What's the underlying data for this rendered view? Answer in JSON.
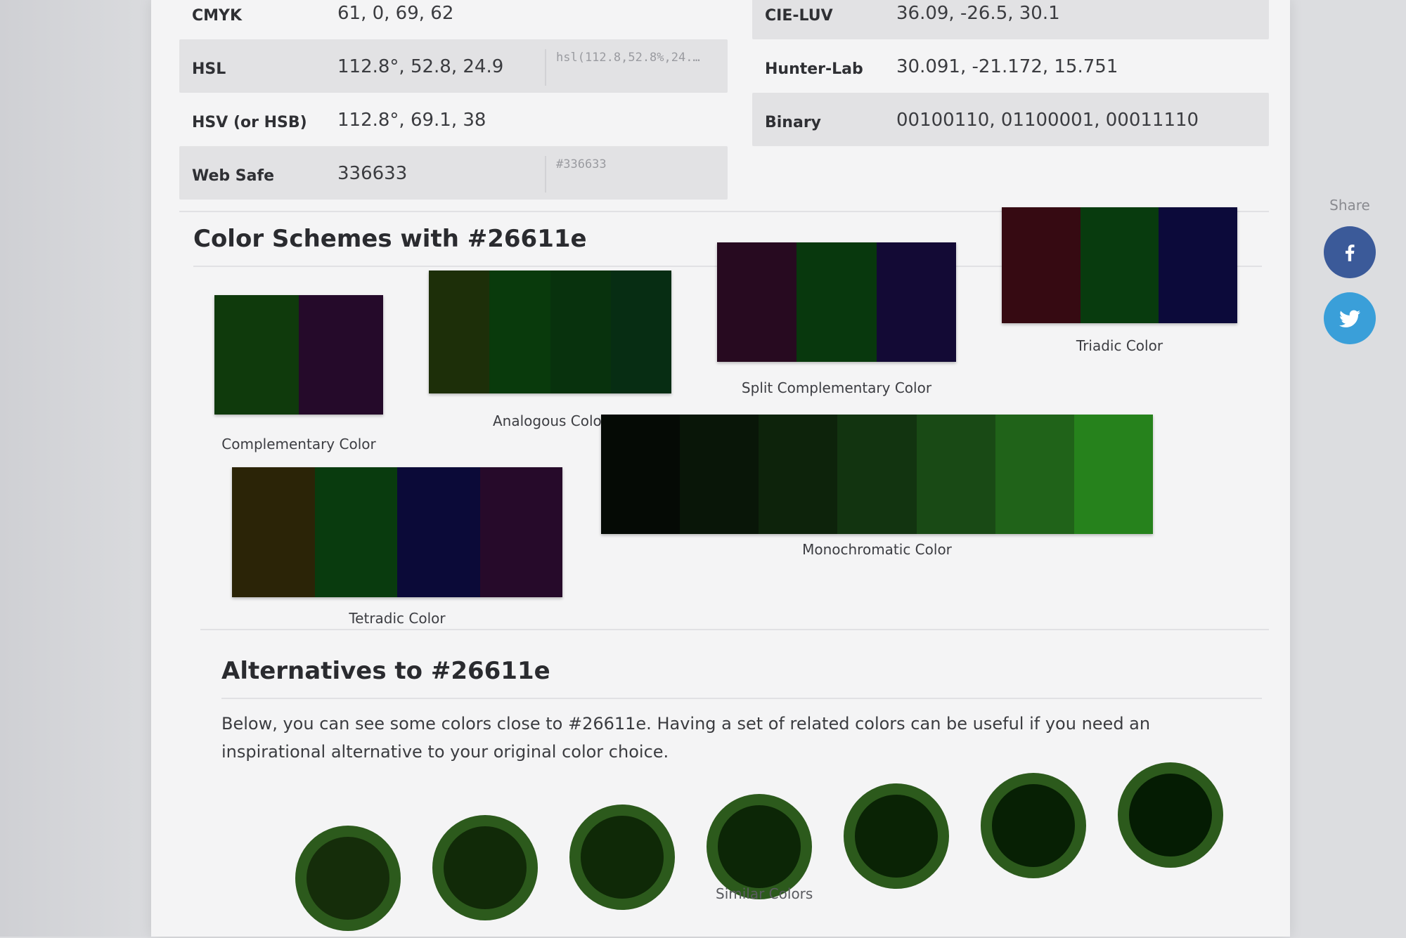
{
  "color": {
    "hex": "#26611e"
  },
  "conversions": {
    "left": [
      {
        "label": "CMYK",
        "value": "61, 0, 69, 62",
        "css": ""
      },
      {
        "label": "HSL",
        "value": "112.8°, 52.8, 24.9",
        "css": "hsl(112.8,52.8%,24.…"
      },
      {
        "label": "HSV (or HSB)",
        "value": "112.8°, 69.1, 38",
        "css": ""
      },
      {
        "label": "Web Safe",
        "value": "336633",
        "css": "#336633"
      }
    ],
    "right": [
      {
        "label": "CIE-LUV",
        "value": "36.09, -26.5, 30.1"
      },
      {
        "label": "Hunter-Lab",
        "value": "30.091, -21.172, 15.751"
      },
      {
        "label": "Binary",
        "value": "00100110, 01100001, 00011110"
      }
    ]
  },
  "schemes": {
    "heading": "Color Schemes with #26611e",
    "items": [
      {
        "label": "Complementary Color",
        "colors": [
          "#0f3a0c",
          "#250a2a"
        ]
      },
      {
        "label": "Analogous Color",
        "colors": [
          "#1d2f09",
          "#093a0c",
          "#08320d",
          "#072d13"
        ]
      },
      {
        "label": "Split Complementary Color",
        "colors": [
          "#270a20",
          "#08380d",
          "#130a35"
        ]
      },
      {
        "label": "Triadic Color",
        "colors": [
          "#360a12",
          "#083b0e",
          "#0c0a3a"
        ]
      },
      {
        "label": "Tetradic Color",
        "colors": [
          "#2b2407",
          "#093b0e",
          "#0b0a38",
          "#260a2a"
        ]
      },
      {
        "label": "Monochromatic Color",
        "colors": [
          "#050a05",
          "#091608",
          "#0d230b",
          "#123410",
          "#194a15",
          "#206319",
          "#26821c"
        ]
      }
    ]
  },
  "alternatives": {
    "heading": "Alternatives to #26611e",
    "description": "Below, you can see some colors close to #26611e. Having a set of related colors can be useful if you need an inspirational alternative to your original color choice.",
    "similar_label": "Similar Colors",
    "circles": [
      "#152d0a",
      "#112a08",
      "#0f2907",
      "#0c2606",
      "#0a2305",
      "#072004",
      "#051c03"
    ]
  },
  "share": {
    "label": "Share",
    "buttons": [
      {
        "name": "facebook",
        "color": "#3b5a99"
      },
      {
        "name": "twitter",
        "color": "#3a9fd9"
      }
    ]
  }
}
